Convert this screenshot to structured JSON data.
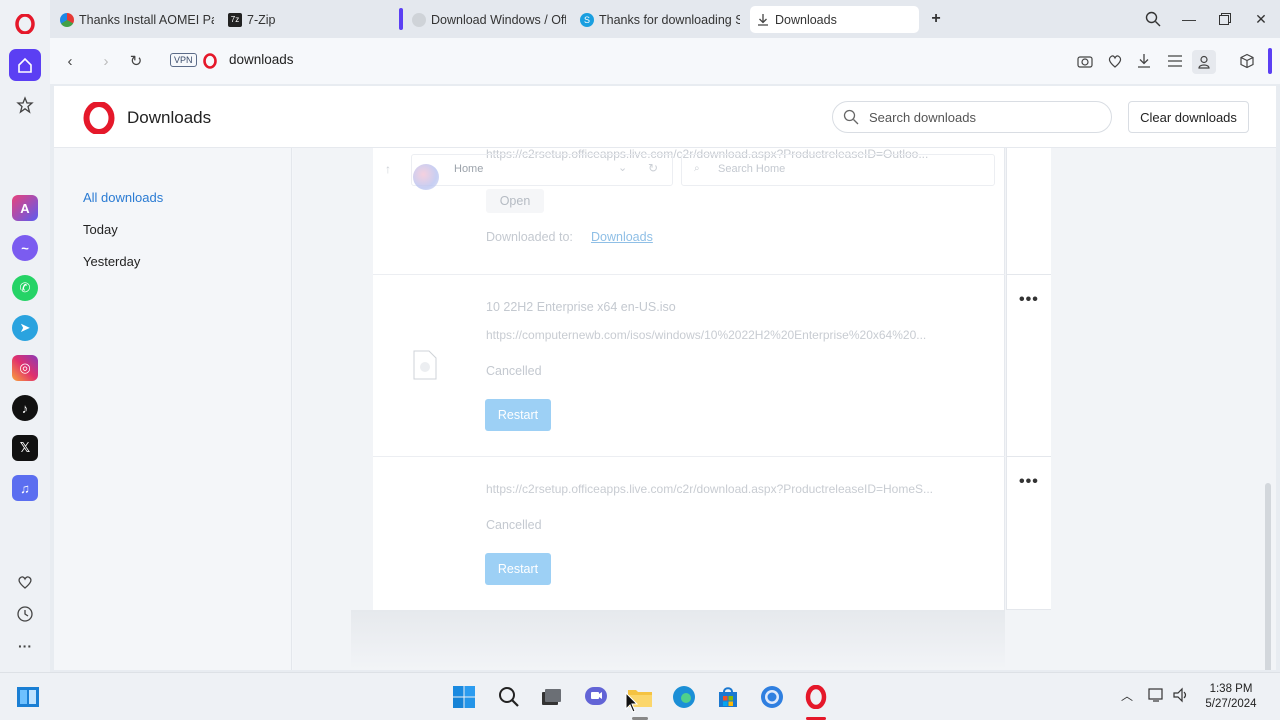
{
  "tabs": [
    {
      "label": "Thanks Install AOMEI Part",
      "icon": "aomei-icon"
    },
    {
      "label": "7-Zip",
      "icon": "7zip-icon"
    },
    {
      "label": "Download Windows / Offi",
      "icon": "gear-icon"
    },
    {
      "label": "Thanks for downloading S",
      "icon": "skype-icon"
    },
    {
      "label": "Downloads",
      "icon": "download-icon"
    }
  ],
  "address": {
    "vpn_label": "VPN",
    "url": "downloads"
  },
  "page": {
    "title": "Downloads",
    "search_placeholder": "Search downloads",
    "clear_label": "Clear downloads"
  },
  "nav": {
    "all": "All downloads",
    "today": "Today",
    "yesterday": "Yesterday"
  },
  "downloads": [
    {
      "url": "https://c2rsetup.officeapps.live.com/c2r/download.aspx?ProductreleaseID=Outloo...",
      "ghost_home": "Home",
      "ghost_search": "Search Home",
      "open_label": "Open",
      "downloaded_to_label": "Downloaded to:",
      "downloaded_to_link": "Downloads"
    },
    {
      "name": "10 22H2 Enterprise x64 en-US.iso",
      "url": "https://computernewb.com/isos/windows/10%2022H2%20Enterprise%20x64%20...",
      "status": "Cancelled",
      "action": "Restart"
    },
    {
      "url": "https://c2rsetup.officeapps.live.com/c2r/download.aspx?ProductreleaseID=HomeS...",
      "status": "Cancelled",
      "action": "Restart"
    }
  ],
  "more_label": "•••",
  "clock": {
    "time": "1:38 PM",
    "date": "5/27/2024"
  },
  "colors": {
    "accent": "#2a7bd3",
    "opera_red": "#e5182a",
    "restart_btn": "#9dd0f5",
    "sidebar_home": "#5b3ff3"
  }
}
